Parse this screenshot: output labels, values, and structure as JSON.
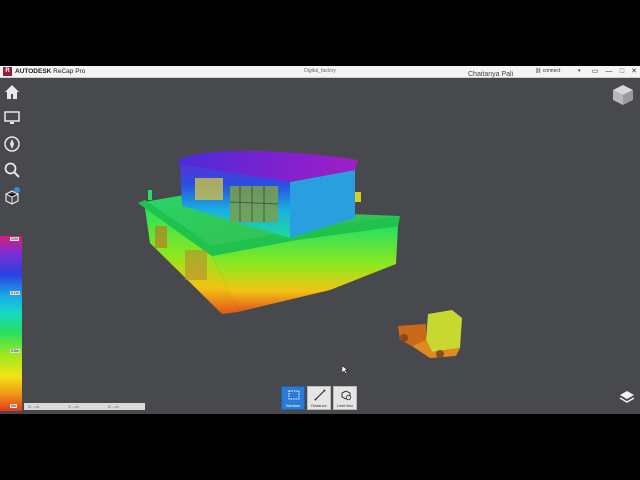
{
  "titlebar": {
    "logo_letter": "R",
    "brand_bold": "AUTODESK",
    "brand_product": "ReCap Pro",
    "document_title": "Digital_factory",
    "user_partial": "Chaitanya Pali",
    "connect_label": "connect",
    "connect_caret": "▾",
    "buttons": [
      "▭",
      "—",
      "□",
      "✕"
    ]
  },
  "sidebar": {
    "items": [
      {
        "icon": "home-icon"
      },
      {
        "icon": "monitor-icon"
      },
      {
        "icon": "compass-icon"
      },
      {
        "icon": "search-icon"
      },
      {
        "icon": "point-cloud-icon"
      }
    ]
  },
  "legend": {
    "ticks": [
      "12m",
      "9.1m",
      "5.6m",
      "0m"
    ]
  },
  "coordinates": {
    "x": "X: --m",
    "y": "Y: --m",
    "z": "Z: --m"
  },
  "toolbar": {
    "items": [
      {
        "label": "Window",
        "icon": "window-select-icon",
        "active": true
      },
      {
        "label": "Distance",
        "icon": "distance-icon",
        "active": false
      },
      {
        "label": "Limit Box",
        "icon": "limit-box-icon",
        "active": false
      }
    ]
  },
  "colors": {
    "viewport_bg": "#48494c",
    "active_tool": "#2b7bd6",
    "brand_logo": "#9b1b3a"
  }
}
